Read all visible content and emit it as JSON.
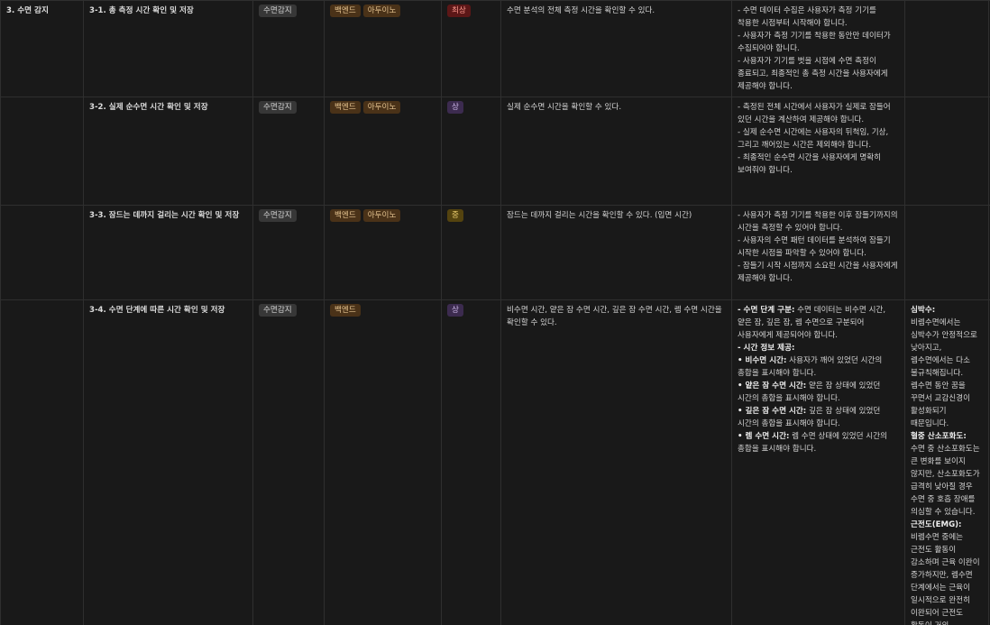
{
  "rows": [
    {
      "section": "3. 수면 감지",
      "feature": "3-1. 총 측정 시간 확인 및 저장",
      "category": "수면감지",
      "tags": [
        "백엔드",
        "아두이노"
      ],
      "priority": "최상",
      "description": "수면 분석의 전체 측정 시간을 확인할 수 있다.",
      "requirements": [
        "- 수면 데이터 수집은 사용자가 측정 기기를 착용한 시점부터 시작해야 합니다.",
        "- 사용자가 측정 기기를 착용한 동안만 데이터가 수집되어야 합니다.",
        "- 사용자가 기기를 벗을 시점에 수면 측정이 종료되고, 최종적인 총 측정 시간을 사용자에게 제공해야 합니다."
      ],
      "notes": []
    },
    {
      "section": "",
      "feature": "3-2. 실제 순수면 시간 확인 및 저장",
      "category": "수면감지",
      "tags": [
        "백엔드",
        "아두이노"
      ],
      "priority": "상",
      "description": "실제 순수면 시간을 확인할 수 있다.",
      "requirements": [
        "- 측정된 전체 시간에서 사용자가 실제로 잠들어 있던 시간을 계산하여 제공해야 합니다.",
        "- 실제 순수면 시간에는 사용자의 뒤척임, 기상, 그리고 깨어있는 시간은 제외해야 합니다.",
        "- 최종적인 순수면 시간을 사용자에게 명확히 보여줘야 합니다."
      ],
      "notes": []
    },
    {
      "section": "",
      "feature": "3-3. 잠드는 데까지 걸리는 시간 확인 및 저장",
      "category": "수면감지",
      "tags": [
        "백엔드",
        "아두이노"
      ],
      "priority": "중",
      "description": "잠드는 데까지 걸리는 시간을 확인할 수 있다. (입면 시간)",
      "requirements": [
        "- 사용자가 측정 기기를 착용한 이후 잠들기까지의 시간을 측정할 수 있어야 합니다.",
        "- 사용자의 수면 패턴 데이터를 분석하여 잠들기 시작한 시점을 파악할 수 있어야 합니다.",
        "- 잠들기 시작 시점까지 소요된 시간을 사용자에게 제공해야 합니다."
      ],
      "notes": []
    },
    {
      "section": "",
      "feature": "3-4. 수면 단계에 따른 시간 확인 및 저장",
      "category": "수면감지",
      "tags": [
        "백엔드"
      ],
      "priority": "상",
      "description": "비수면 시간, 얕은 잠 수면 시간, 깊은 잠 수면 시간, 렘 수면 시간을 확인할 수 있다.",
      "requirements": [
        {
          "bold": "- 수면 단계 구분:",
          "text": " 수면 데이터는 비수면 시간, 얕은 잠, 깊은 잠, 렘 수면으로 구분되어 사용자에게 제공되어야 합니다."
        },
        {
          "bold": "- 시간 정보 제공:",
          "text": ""
        },
        {
          "bold": "• 비수면 시간:",
          "text": " 사용자가 깨어 있었던 시간의 총합을 표시해야 합니다."
        },
        {
          "bold": "• 얕은 잠 수면 시간:",
          "text": " 얕은 잠 상태에 있었던 시간의 총합을 표시해야 합니다."
        },
        {
          "bold": "• 깊은 잠 수면 시간:",
          "text": " 깊은 잠 상태에 있었던 시간의 총합을 표시해야 합니다."
        },
        {
          "bold": "• 렘 수면 시간:",
          "text": " 렘 수면 상태에 있었던 시간의 총합을 표시해야 합니다."
        }
      ],
      "notes": [
        {
          "bold": "심박수:",
          "text": " 비렘수면에서는 심박수가 안정적으로 낮아지고, 렘수면에서는 다소 불규칙해집니다. 렘수면 동안 꿈을 꾸면서 교감신경이 활성화되기 때문입니다."
        },
        {
          "bold": "혈중 산소포화도:",
          "text": " 수면 중 산소포화도는 큰 변화를 보이지 않지만, 산소포화도가 급격히 낮아질 경우 수면 중 호흡 장애를 의심할 수 있습니다."
        },
        {
          "bold": "근전도(EMG):",
          "text": " 비렘수면 중에는 근전도 활동이 감소하며 근육 이완이 증가하지만, 렘수면 단계에서는 근육이 일시적으로 완전히 이완되어 근전도 활동이 거의 없어집니다."
        }
      ]
    }
  ],
  "colors": {
    "background": "#191919",
    "border": "#2f2f2f",
    "tag_gray": "#373737",
    "tag_brown": "#4a3218",
    "tag_red": "#5c1717",
    "tag_purple": "#3c2b4f",
    "tag_yellow": "#54430f"
  }
}
